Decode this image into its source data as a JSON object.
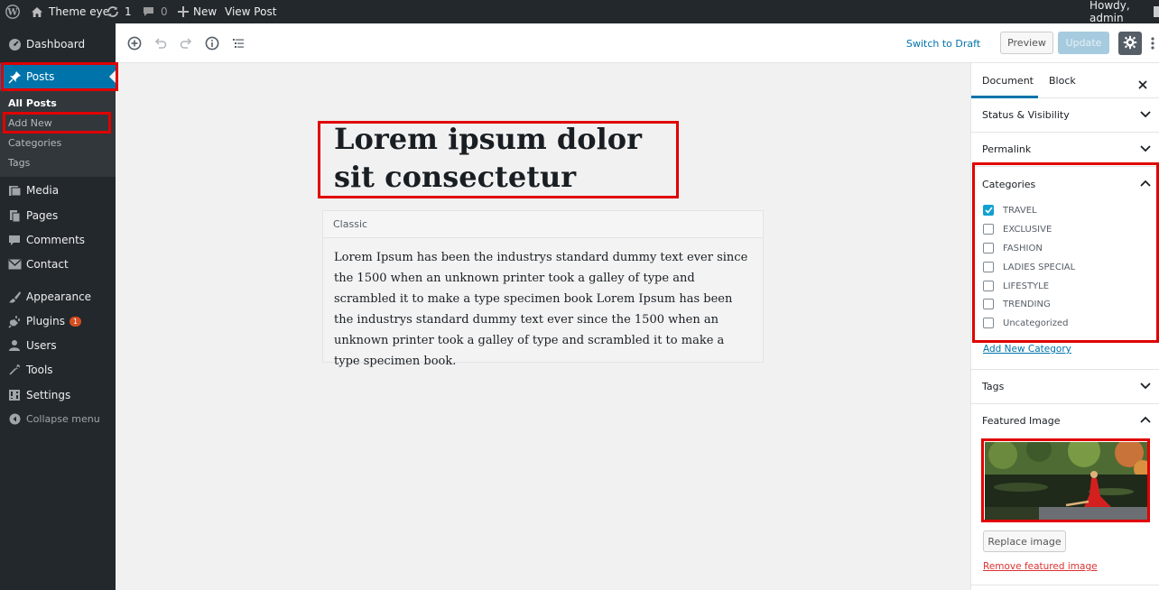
{
  "adminbar": {
    "site_name": "Theme eye",
    "updates_count": "1",
    "comments_count": "0",
    "new_label": "New",
    "view_post_label": "View Post",
    "howdy": "Howdy, admin"
  },
  "sidebar": {
    "dashboard": "Dashboard",
    "posts": "Posts",
    "sub": [
      "All Posts",
      "Add New",
      "Categories",
      "Tags"
    ],
    "media": "Media",
    "pages": "Pages",
    "comments": "Comments",
    "contact": "Contact",
    "appearance": "Appearance",
    "plugins": "Plugins",
    "plugins_badge": "1",
    "users": "Users",
    "tools": "Tools",
    "settings": "Settings",
    "collapse": "Collapse menu"
  },
  "toolbar": {
    "switch_to_draft": "Switch to Draft",
    "preview": "Preview",
    "update": "Update"
  },
  "editor": {
    "title": "Lorem ipsum dolor sit consectetur",
    "block_label": "Classic",
    "body": "Lorem Ipsum has been the industrys standard dummy text ever since the 1500 when an unknown printer took a galley of type and scrambled it to make a type specimen book Lorem Ipsum has been the industrys standard dummy text ever since the 1500 when an unknown printer took a galley of type and scrambled it to make a type specimen book."
  },
  "settings_panel": {
    "tabs": [
      "Document",
      "Block"
    ],
    "status_visibility": "Status & Visibility",
    "permalink": "Permalink",
    "categories_title": "Categories",
    "categories": [
      {
        "label": "TRAVEL",
        "checked": true
      },
      {
        "label": "EXCLUSIVE",
        "checked": false
      },
      {
        "label": "FASHION",
        "checked": false
      },
      {
        "label": "LADIES SPECIAL",
        "checked": false
      },
      {
        "label": "LIFESTYLE",
        "checked": false
      },
      {
        "label": "TRENDING",
        "checked": false
      },
      {
        "label": "Uncategorized",
        "checked": false
      }
    ],
    "add_new_category": "Add New Category",
    "tags": "Tags",
    "featured_image": "Featured Image",
    "replace_image": "Replace image",
    "remove_featured_image": "Remove featured image"
  },
  "colors": {
    "admin_dark": "#23282d",
    "wp_blue": "#0073aa",
    "highlight_red": "#e00000"
  }
}
